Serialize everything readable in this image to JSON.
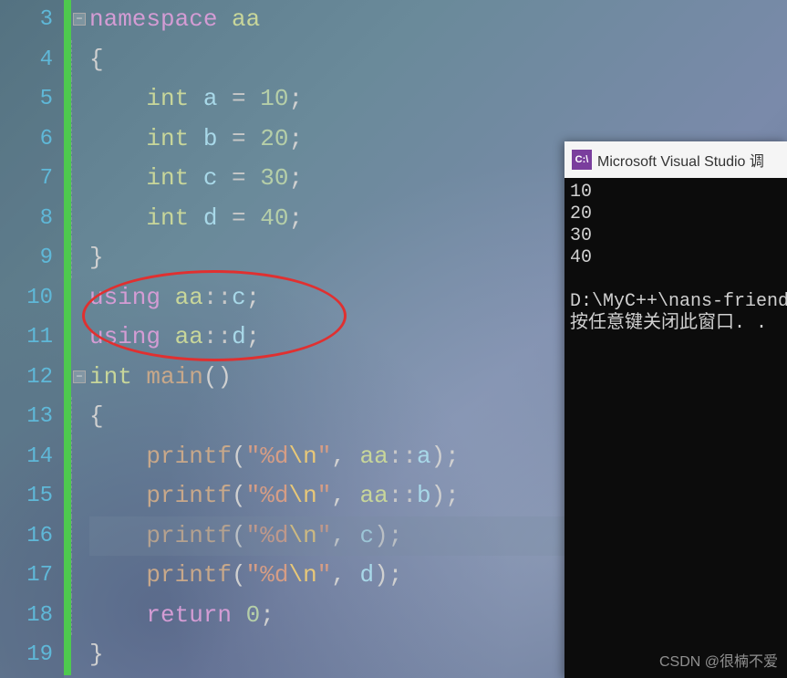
{
  "lines": [
    {
      "num": "3",
      "collapse": true
    },
    {
      "num": "4"
    },
    {
      "num": "5"
    },
    {
      "num": "6"
    },
    {
      "num": "7"
    },
    {
      "num": "8"
    },
    {
      "num": "9"
    },
    {
      "num": "10"
    },
    {
      "num": "11"
    },
    {
      "num": "12",
      "collapse": true
    },
    {
      "num": "13"
    },
    {
      "num": "14"
    },
    {
      "num": "15"
    },
    {
      "num": "16",
      "highlight": true
    },
    {
      "num": "17"
    },
    {
      "num": "18"
    },
    {
      "num": "19"
    }
  ],
  "code": {
    "l3_namespace": "namespace",
    "l3_aa": "aa",
    "l4_brace": "{",
    "l5_int": "int",
    "l5_a": "a",
    "l5_eq": " = ",
    "l5_10": "10",
    "l5_semi": ";",
    "l6_int": "int",
    "l6_b": "b",
    "l6_eq": " = ",
    "l6_20": "20",
    "l6_semi": ";",
    "l7_int": "int",
    "l7_c": "c",
    "l7_eq": " = ",
    "l7_30": "30",
    "l7_semi": ";",
    "l8_int": "int",
    "l8_d": "d",
    "l8_eq": " = ",
    "l8_40": "40",
    "l8_semi": ";",
    "l9_brace": "}",
    "l10_using": "using",
    "l10_aa": "aa",
    "l10_scope": "::",
    "l10_c": "c",
    "l10_semi": ";",
    "l11_using": "using",
    "l11_aa": "aa",
    "l11_scope": "::",
    "l11_d": "d",
    "l11_semi": ";",
    "l12_int": "int",
    "l12_main": "main",
    "l12_parens": "()",
    "l13_brace": "{",
    "l14_printf": "printf",
    "l14_open": "(",
    "l14_q1": "\"",
    "l14_fmt": "%d",
    "l14_esc": "\\n",
    "l14_q2": "\"",
    "l14_comma": ", ",
    "l14_aa": "aa",
    "l14_scope": "::",
    "l14_a": "a",
    "l14_close": ");",
    "l15_printf": "printf",
    "l15_open": "(",
    "l15_q1": "\"",
    "l15_fmt": "%d",
    "l15_esc": "\\n",
    "l15_q2": "\"",
    "l15_comma": ", ",
    "l15_aa": "aa",
    "l15_scope": "::",
    "l15_b": "b",
    "l15_close": ");",
    "l16_printf": "printf",
    "l16_open": "(",
    "l16_q1": "\"",
    "l16_fmt": "%d",
    "l16_esc": "\\n",
    "l16_q2": "\"",
    "l16_comma": ", ",
    "l16_c": "c",
    "l16_close": ");",
    "l17_printf": "printf",
    "l17_open": "(",
    "l17_q1": "\"",
    "l17_fmt": "%d",
    "l17_esc": "\\n",
    "l17_q2": "\"",
    "l17_comma": ", ",
    "l17_d": "d",
    "l17_close": ");",
    "l18_return": "return",
    "l18_0": "0",
    "l18_semi": ";",
    "l19_brace": "}"
  },
  "console": {
    "title": "Microsoft Visual Studio 调",
    "out1": "10",
    "out2": "20",
    "out3": "30",
    "out4": "40",
    "path": "D:\\MyC++\\nans-friend",
    "prompt": "按任意键关闭此窗口. ."
  },
  "watermark": "CSDN @很楠不爱",
  "collapse_symbol": "−"
}
